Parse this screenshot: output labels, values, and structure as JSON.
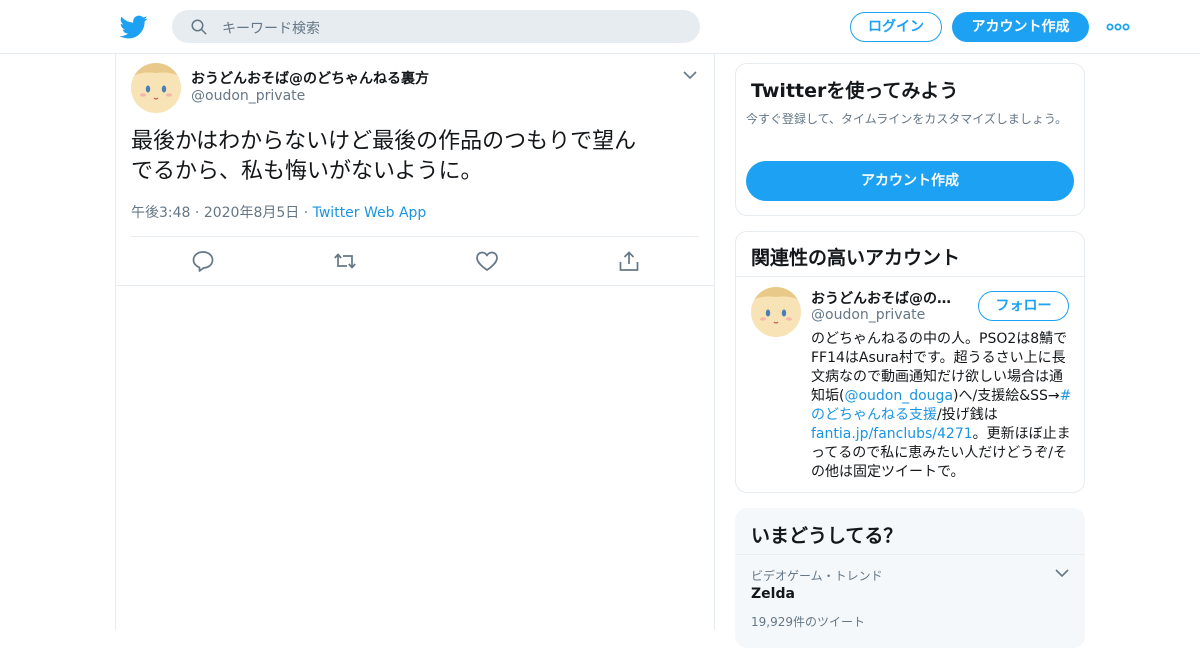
{
  "header": {
    "search_placeholder": "キーワード検索",
    "login_label": "ログイン",
    "signup_label": "アカウント作成"
  },
  "tweet": {
    "author_name": "おうどんおそば@のどちゃんねる裏方",
    "author_handle": "@oudon_private",
    "text_line1": "最後かはわからないけど最後の作品のつもりで望ん",
    "text_line2": "でるから、私も悔いがないように。",
    "time": "午後3:48",
    "date": "2020年8月5日",
    "source": "Twitter Web App"
  },
  "signup_card": {
    "title": "Twitterを使ってみよう",
    "description": "今すぐ登録して、タイムラインをカスタマイズしましょう。",
    "button_label": "アカウント作成"
  },
  "related": {
    "title": "関連性の高いアカウント",
    "name": "おうどんおそば@の…",
    "handle": "@oudon_private",
    "follow_label": "フォロー",
    "bio": {
      "t1": "のどちゃんねるの中の人。PSO2は8鯖でFF14はAsura村です。超うるさい上に長文病なので動画通知だけ欲しい場合は通知垢(",
      "link1": "@oudon_douga",
      "t2": ")へ/支援絵&SS→",
      "link2": "#のどちゃんねる支援",
      "t3": "/投げ銭は",
      "link3": "fantia.jp/fanclubs/4271",
      "t4": "。更新ほぼ止まってるので私に恵みたい人だけどうぞ/その他は固定ツイートで。"
    }
  },
  "trends": {
    "title": "いまどうしてる？",
    "category": "ビデオゲーム・トレンド",
    "name": "Zelda",
    "count": "19,929件のツイート"
  },
  "colors": {
    "accent": "#1da1f2",
    "link": "#1b95e0",
    "secondary_text": "#657786",
    "border": "#e6ecf0"
  }
}
